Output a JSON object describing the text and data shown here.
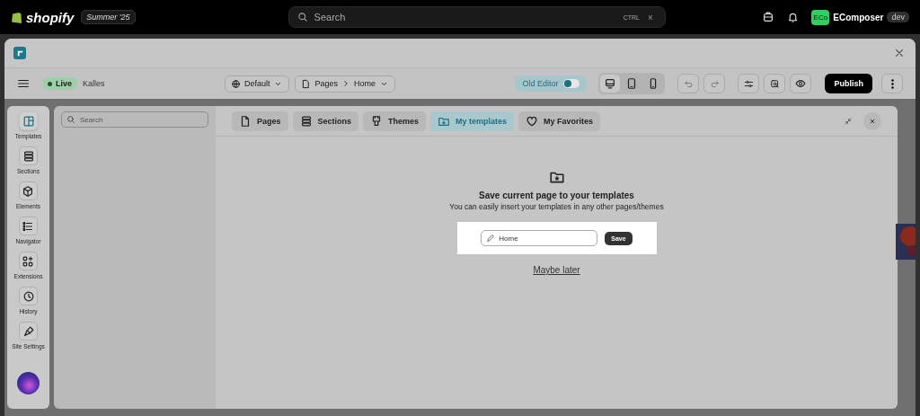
{
  "topbar": {
    "brand": "shopify",
    "edition": "Summer '25",
    "search": {
      "placeholder": "Search"
    },
    "shortcut": [
      "CTRL",
      "K"
    ],
    "store_badge": "ECo",
    "store_name": "EComposer",
    "store_tag": "dev"
  },
  "toolbar": {
    "status": "Live",
    "store": "Kalles",
    "language": "Default",
    "breadcrumb": [
      "Pages",
      "Home"
    ],
    "old_editor": {
      "label": "Old Editor",
      "on": false
    },
    "devices": [
      {
        "kind": "desktop",
        "selected": true
      },
      {
        "kind": "tablet",
        "selected": false
      },
      {
        "kind": "mobile",
        "selected": false
      }
    ],
    "publish": "Publish"
  },
  "rail": [
    {
      "label": "Templates",
      "kind": "templates",
      "selected": true
    },
    {
      "label": "Sections",
      "kind": "sections",
      "selected": false
    },
    {
      "label": "Elements",
      "kind": "elements",
      "selected": false
    },
    {
      "label": "Navigator",
      "kind": "navigator",
      "selected": false
    },
    {
      "label": "Extensions",
      "kind": "extensions",
      "selected": false
    },
    {
      "label": "History",
      "kind": "history",
      "selected": false
    },
    {
      "label": "Site Settings",
      "kind": "settings",
      "selected": false
    }
  ],
  "modal": {
    "search": {
      "placeholder": "Search"
    },
    "tabs": [
      {
        "label": "Pages",
        "kind": "page",
        "selected": false
      },
      {
        "label": "Sections",
        "kind": "sections",
        "selected": false
      },
      {
        "label": "Themes",
        "kind": "themes",
        "selected": false
      },
      {
        "label": "My templates",
        "kind": "folder",
        "selected": true
      },
      {
        "label": "My Favorites",
        "kind": "heart",
        "selected": false
      }
    ],
    "heading": "Save current page to your templates",
    "subtext": "You can easily insert your templates in any other pages/themes",
    "name_field": {
      "value": "Home"
    },
    "save": "Save",
    "later": "Maybe later"
  }
}
